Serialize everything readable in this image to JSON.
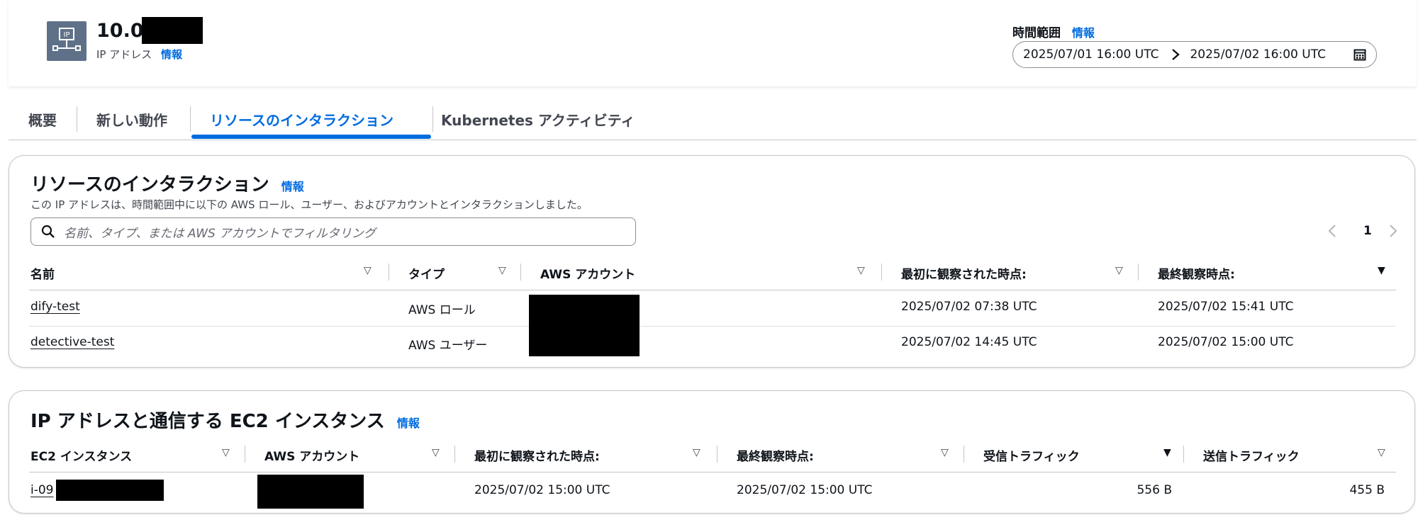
{
  "header": {
    "ip_prefix": "10.0.",
    "subtitle": "IP アドレス",
    "info": "情報",
    "time_range_label": "時間範囲",
    "time_range_info": "情報",
    "start": "2025/07/01 16:00 UTC",
    "end": "2025/07/02 16:00 UTC"
  },
  "tabs": [
    {
      "label": "概要"
    },
    {
      "label": "新しい動作"
    },
    {
      "label": "リソースのインタラクション"
    },
    {
      "label": "Kubernetes アクティビティ"
    }
  ],
  "resource_panel": {
    "title": "リソースのインタラクション",
    "info": "情報",
    "description": "この IP アドレスは、時間範囲中に以下の AWS ロール、ユーザー、およびアカウントとインタラクションしました。",
    "search_placeholder": "名前、タイプ、または AWS アカウントでフィルタリング",
    "page": "1",
    "columns": [
      "名前",
      "タイプ",
      "AWS アカウント",
      "最初に観察された時点:",
      "最終観察時点:"
    ],
    "rows": [
      {
        "name": "dify-test",
        "type": "AWS ロール",
        "first": "2025/07/02 07:38 UTC",
        "last": "2025/07/02 15:41 UTC"
      },
      {
        "name": "detective-test",
        "type": "AWS ユーザー",
        "first": "2025/07/02 14:45 UTC",
        "last": "2025/07/02 15:00 UTC"
      }
    ]
  },
  "ec2_panel": {
    "title": "IP アドレスと通信する EC2 インスタンス",
    "info": "情報",
    "columns": [
      "EC2 インスタンス",
      "AWS アカウント",
      "最初に観察された時点:",
      "最終観察時点:",
      "受信トラフィック",
      "送信トラフィック"
    ],
    "rows": [
      {
        "instance_prefix": "i-09",
        "first": "2025/07/02 15:00 UTC",
        "last": "2025/07/02 15:00 UTC",
        "inbound": "556 B",
        "outbound": "455 B"
      }
    ]
  },
  "colors": {
    "accent": "#006ce0",
    "icon_bg": "#5f7189"
  }
}
